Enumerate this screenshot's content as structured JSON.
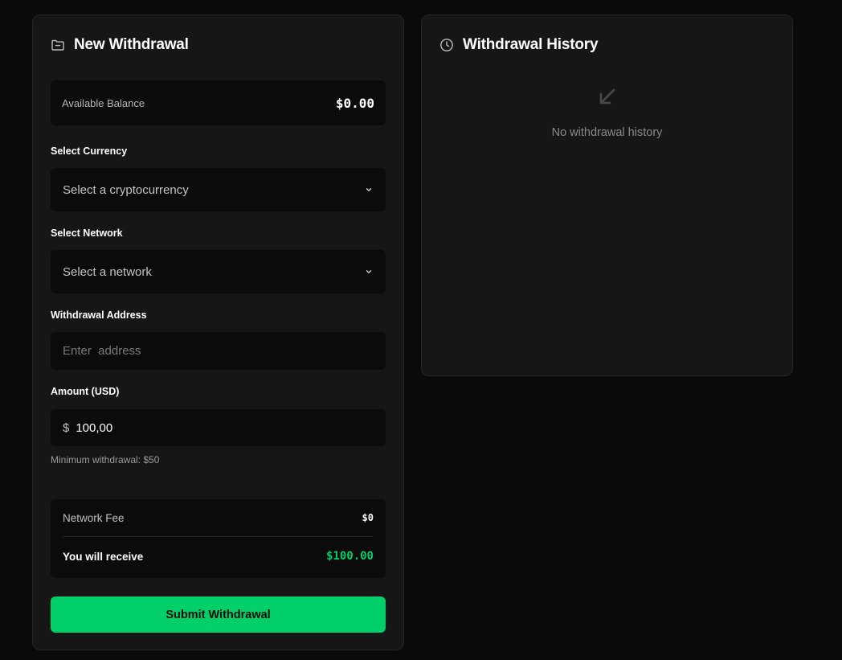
{
  "withdraw": {
    "title": "New Withdrawal",
    "balance_label": "Available Balance",
    "balance_value": "$0.00",
    "currency_label": "Select Currency",
    "currency_placeholder": "Select a cryptocurrency",
    "network_label": "Select Network",
    "network_placeholder": "Select a network",
    "address_label": "Withdrawal Address",
    "address_placeholder": "Enter  address",
    "amount_label": "Amount (USD)",
    "amount_symbol": "$",
    "amount_value": "100,00",
    "min_hint": "Minimum withdrawal: $50",
    "fee_label": "Network Fee",
    "fee_value": "$0",
    "receive_label": "You will receive",
    "receive_value": "$100.00",
    "submit_label": "Submit Withdrawal"
  },
  "history": {
    "title": "Withdrawal History",
    "empty_text": "No withdrawal history"
  },
  "icons": {
    "withdraw_header": "folder-icon",
    "history_header": "clock-icon",
    "select_chevron": "chevron-down-icon",
    "empty_state": "arrow-down-left-icon"
  },
  "colors": {
    "accent": "#00cf6a",
    "receive_amount": "#00cf6c",
    "background": "#0a0a0a",
    "panel": "#161616",
    "field": "#0b0b0b"
  }
}
